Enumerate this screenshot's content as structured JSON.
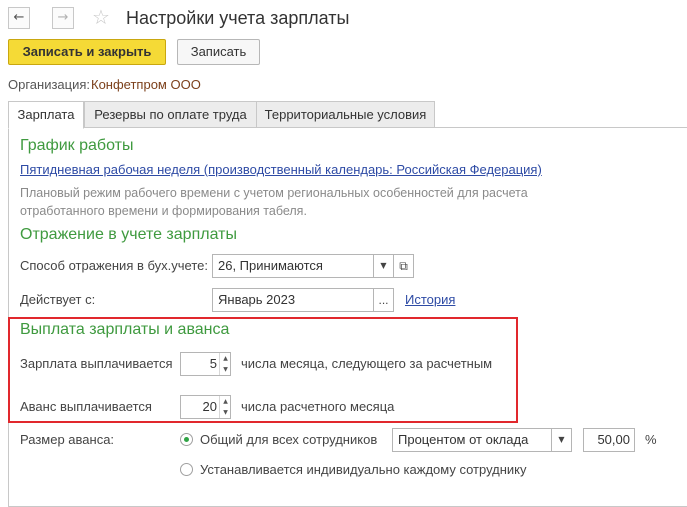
{
  "nav": {
    "back_icon": "←",
    "forward_icon": "→",
    "favorite_icon": "☆"
  },
  "title": "Настройки учета зарплаты",
  "toolbar": {
    "save_close_label": "Записать и закрыть",
    "save_label": "Записать"
  },
  "organization": {
    "label": "Организация:",
    "value": "Конфетпром ООО"
  },
  "tabs": [
    {
      "label": "Зарплата",
      "active": true
    },
    {
      "label": "Резервы по оплате труда",
      "active": false
    },
    {
      "label": "Территориальные условия",
      "active": false
    }
  ],
  "schedule": {
    "heading": "График работы",
    "link": "Пятидневная рабочая неделя (производственный календарь: Российская Федерация)",
    "note_line1": "Плановый режим рабочего времени с учетом региональных особенностей для расчета",
    "note_line2": "отработанного времени и формирования табеля."
  },
  "accounting": {
    "heading": "Отражение в учете зарплаты",
    "method_label": "Способ отражения в бух.учете:",
    "method_value": "26, Принимаются",
    "effective_label": "Действует с:",
    "effective_value": "Январь 2023",
    "ellipsis": "...",
    "history_link": "История",
    "dropdown_icon": "▼",
    "open_icon": "⧉"
  },
  "payment": {
    "heading": "Выплата зарплаты и аванса",
    "salary_label": "Зарплата выплачивается",
    "salary_day": "5",
    "salary_suffix": "числа месяца, следующего за расчетным",
    "advance_label": "Аванс выплачивается",
    "advance_day": "20",
    "advance_suffix": "числа расчетного месяца",
    "spin_up_icon": "▲",
    "spin_down_icon": "▼"
  },
  "advance_size": {
    "label": "Размер аванса:",
    "option1": "Общий для всех сотрудников",
    "option1_selected": true,
    "method_value": "Процентом от оклада",
    "percent_value": "50,00",
    "percent_sign": "%",
    "option2": "Устанавливается индивидуально каждому сотруднику"
  },
  "colors": {
    "accent_green": "#3f9a3f",
    "highlight_red": "#e1282d",
    "primary_button": "#f5da36",
    "link_blue": "#2e4ba5"
  }
}
